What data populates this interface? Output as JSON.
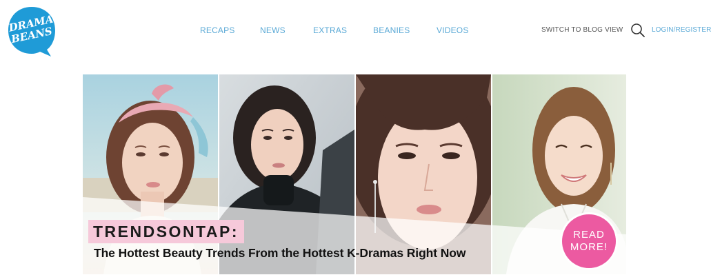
{
  "header": {
    "logo_text": "DRAMA BEANS",
    "nav": [
      {
        "label": "RECAPS"
      },
      {
        "label": "NEWS"
      },
      {
        "label": "EXTRAS"
      },
      {
        "label": "BEANIES"
      },
      {
        "label": "VIDEOS"
      }
    ],
    "blog_toggle_label": "SWITCH TO BLOG VIEW",
    "search_icon": "search-icon",
    "login_label": "LOGIN/REGISTER"
  },
  "hero": {
    "tag": "TRENDSONTAP:",
    "headline": "The Hottest Beauty Trends From the Hottest K-Dramas Right Now",
    "read_more_line1": "READ",
    "read_more_line2": "MORE!",
    "panels": [
      {
        "name": "actress-with-pink-headscarf"
      },
      {
        "name": "actress-in-black-turtleneck"
      },
      {
        "name": "actress-closeup-portrait"
      },
      {
        "name": "actress-smiling-in-white-blouse"
      }
    ]
  },
  "colors": {
    "accent_blue": "#5aa9d6",
    "logo_blue": "#1f9bd7",
    "tag_pink": "#f6c9da",
    "read_more_pink": "#ec5aa1"
  }
}
